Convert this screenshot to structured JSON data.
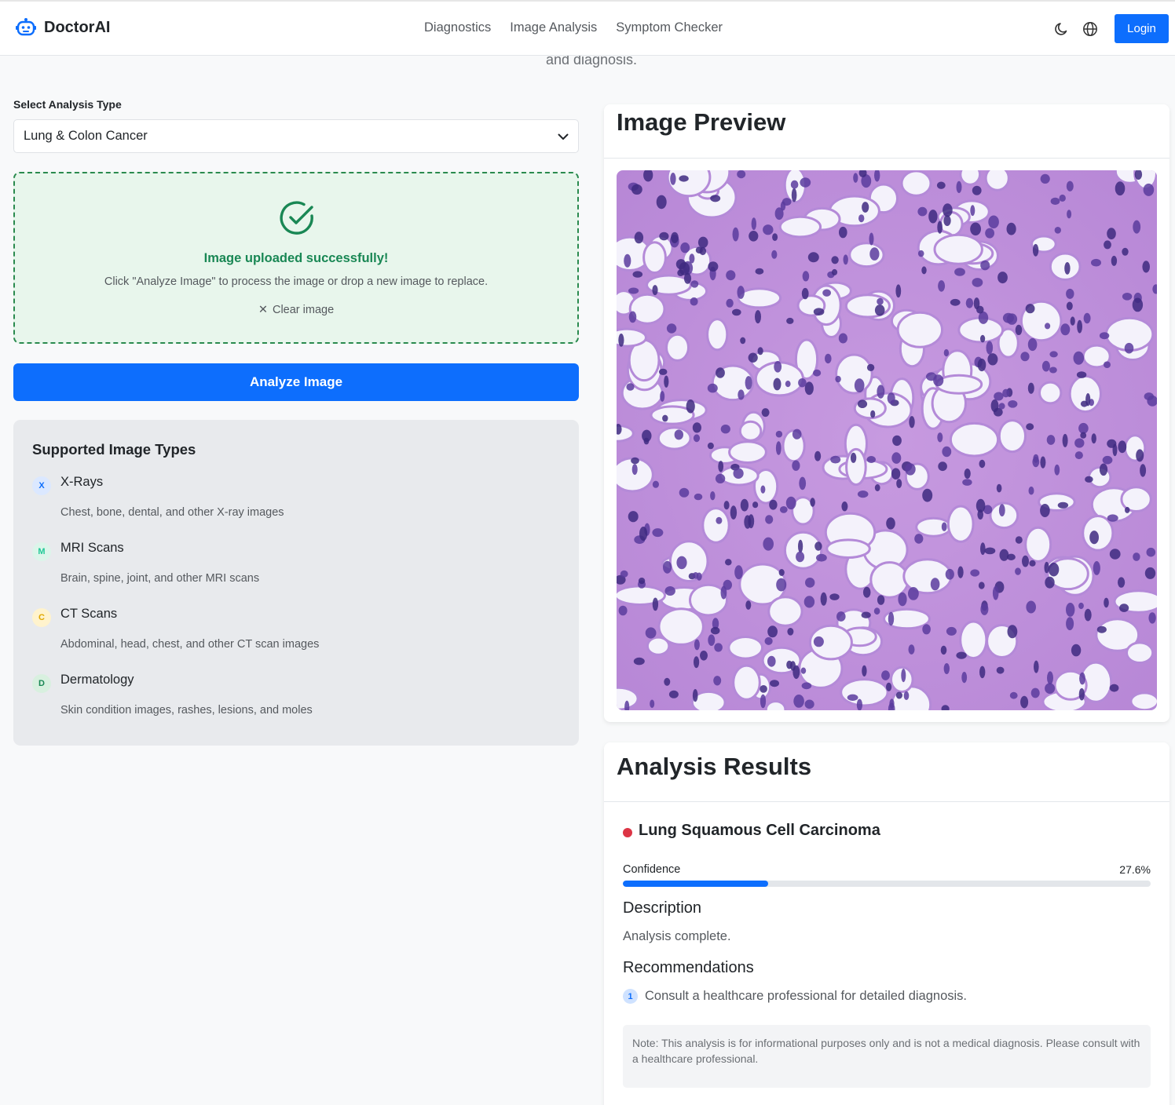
{
  "nav": {
    "brand": "DoctorAI",
    "links": [
      "Diagnostics",
      "Image Analysis",
      "Symptom Checker"
    ],
    "login_label": "Login",
    "icons": [
      "moon-icon",
      "globe-icon"
    ]
  },
  "hero": {
    "subtitle_tail": "and diagnosis."
  },
  "form": {
    "select_label": "Select Analysis Type",
    "select_value": "Lung & Colon Cancer",
    "upload": {
      "title": "Image uploaded successfully!",
      "subtitle": "Click \"Analyze Image\" to process the image or drop a new image to replace.",
      "clear_label": "Clear image"
    },
    "analyze_label": "Analyze Image"
  },
  "supported": {
    "title": "Supported Image Types",
    "items": [
      {
        "badge": "X",
        "name": "X-Rays",
        "desc": "Chest, bone, dental, and other X-ray images",
        "bg": "#dbe8ff",
        "fg": "#0d6efd"
      },
      {
        "badge": "M",
        "name": "MRI Scans",
        "desc": "Brain, spine, joint, and other MRI scans",
        "bg": "#dcf5ea",
        "fg": "#20c997"
      },
      {
        "badge": "C",
        "name": "CT Scans",
        "desc": "Abdominal, head, chest, and other CT scan images",
        "bg": "#fff3cd",
        "fg": "#e0a800"
      },
      {
        "badge": "D",
        "name": "Dermatology",
        "desc": "Skin condition images, rashes, lesions, and moles",
        "bg": "#d8f0df",
        "fg": "#198754"
      }
    ]
  },
  "preview": {
    "title": "Image Preview"
  },
  "results": {
    "title": "Analysis Results",
    "diagnosis": "Lung Squamous Cell Carcinoma",
    "confidence_label": "Confidence",
    "confidence_text": "27.6%",
    "confidence_fraction": 0.276,
    "description_heading": "Description",
    "description": "Analysis complete.",
    "recommendations_heading": "Recommendations",
    "recommendations": [
      {
        "num": "1",
        "text": "Consult a healthcare professional for detailed diagnosis."
      }
    ],
    "note": "Note: This analysis is for informational purposes only and is not a medical diagnosis. Please consult with a healthcare professional."
  },
  "colors": {
    "accent": "#0d6efd",
    "success": "#198754",
    "danger": "#dc3545"
  }
}
